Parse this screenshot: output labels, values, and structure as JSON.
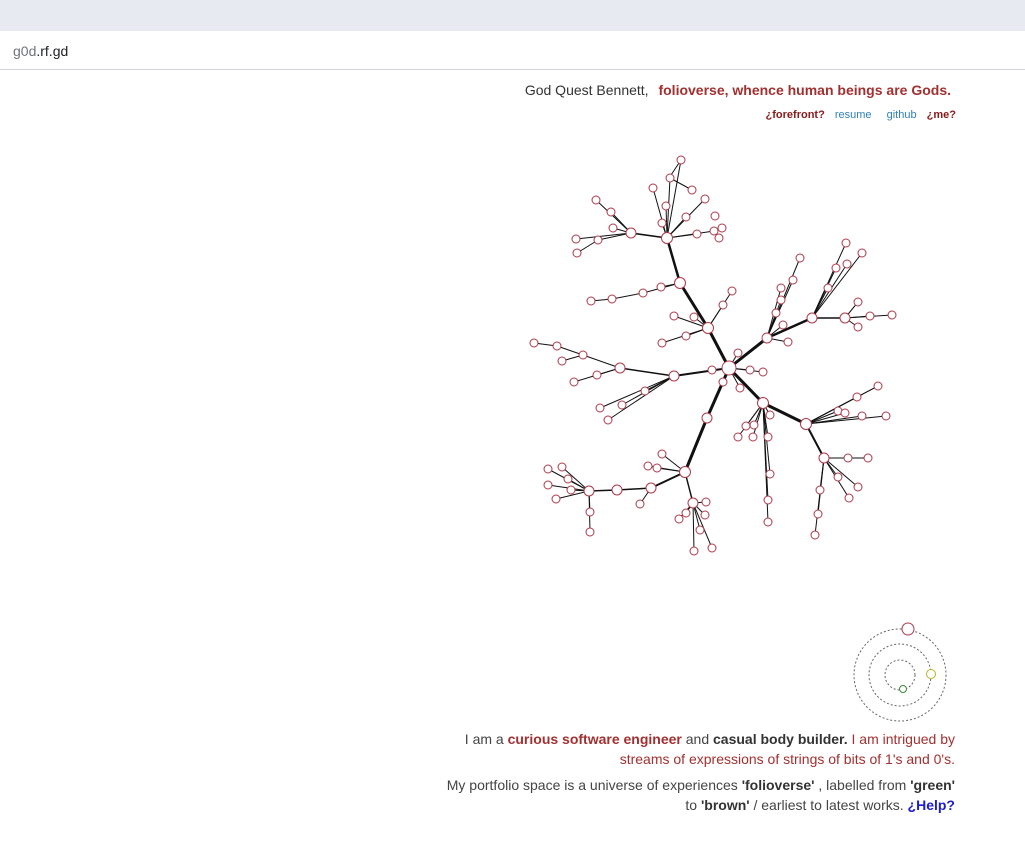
{
  "browser": {
    "url_sub": "g0d",
    "url_domain": ".rf.gd"
  },
  "header": {
    "name": "God Quest Bennett,",
    "tagline": "folioverse, whence human beings are Gods."
  },
  "nav": {
    "forefront": "¿forefront?",
    "resume": "resume",
    "github": "github",
    "me": "¿me?"
  },
  "bio": {
    "p1_a": "I am a",
    "p1_b": "curious software engineer",
    "p1_c": "and",
    "p1_d": "casual body builder.",
    "p1_e": "I am intrigued by",
    "p1_f": "streams of expressions of strings of bits of 1's and 0's.",
    "p2_a": "My portfolio space is a universe of experiences",
    "p2_b": "'folioverse'",
    "p2_c": ", labelled from",
    "p2_d": "'green'",
    "p2_e": "to",
    "p2_f": "'brown'",
    "p2_g": "/ earliest to latest works.",
    "p2_help": "¿Help?"
  },
  "colors": {
    "node_stroke": "#b0384a",
    "edge": "#111111",
    "accent_red": "#a33030",
    "link_blue": "#2f7fbf",
    "help_blue": "#1c1cd0",
    "orbit_green": "#3a8a3a",
    "orbit_yellow": "#b5b52a"
  }
}
